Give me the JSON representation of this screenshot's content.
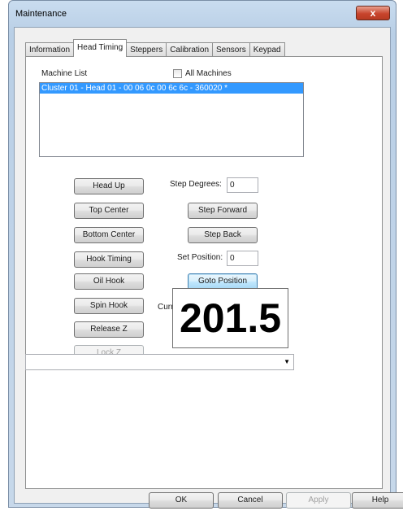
{
  "window": {
    "title": "Maintenance",
    "close_label": "x"
  },
  "tabs": [
    {
      "label": "Information"
    },
    {
      "label": "Head Timing"
    },
    {
      "label": "Steppers"
    },
    {
      "label": "Calibration"
    },
    {
      "label": "Sensors"
    },
    {
      "label": "Keypad"
    }
  ],
  "active_tab": "Head Timing",
  "machine_list": {
    "label": "Machine List",
    "all_machines_label": "All Machines",
    "all_machines_checked": false,
    "items": [
      "Cluster 01 - Head 01 - 00 06 0c 00 6c 6c - 360020 *"
    ],
    "selected_index": 0
  },
  "left_buttons": {
    "head_up": "Head Up",
    "top_center": "Top Center",
    "bottom_center": "Bottom Center",
    "hook_timing": "Hook Timing",
    "oil_hook": "Oil Hook",
    "spin_hook": "Spin Hook",
    "release_z": "Release Z",
    "lock_z": "Lock Z"
  },
  "step": {
    "degrees_label": "Step Degrees:",
    "degrees_value": "0",
    "forward_label": "Step Forward",
    "back_label": "Step Back"
  },
  "position": {
    "set_label": "Set Position:",
    "set_value": "0",
    "goto_label": "Goto Position"
  },
  "z_position": {
    "label": "Current Z Position:",
    "value": "201.5"
  },
  "combo": {
    "value": ""
  },
  "dialog_buttons": {
    "ok": "OK",
    "cancel": "Cancel",
    "apply": "Apply",
    "help": "Help"
  },
  "colors": {
    "selection": "#3399ff",
    "focus_border": "#3c7fb1",
    "close_red": "#c8452d"
  }
}
